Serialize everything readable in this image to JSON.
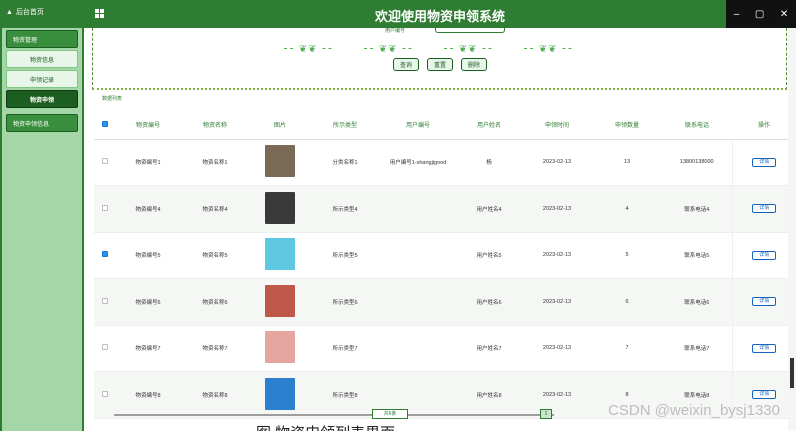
{
  "app": {
    "home_label": "后台首页",
    "title": "欢迎使用物资申领系统",
    "win": {
      "minimize": "–",
      "maximize": "▢",
      "close": "✕"
    }
  },
  "sidebar": {
    "group1": "物资管理",
    "items": [
      "物资信息",
      "申领记录"
    ],
    "active": "物资申领",
    "group2": "物资申领信息"
  },
  "search": {
    "hint": "用户编号",
    "buttons": [
      "查询",
      "重置",
      "删除"
    ]
  },
  "data_label": "数据列表",
  "table": {
    "headers": [
      "物资编号",
      "物资名称",
      "图片",
      "所示类型",
      "用户编号",
      "用户姓名",
      "申领时间",
      "申领数量",
      "联系电话",
      "操作"
    ],
    "rows": [
      {
        "checked": false,
        "code": "物资编号1",
        "name": "物资名称1",
        "img": "#7a6a55",
        "type": "分类名称1",
        "user_id": "用户编号1-shangjigood",
        "user_name": "杨",
        "date": "2023-02-13",
        "qty": "13",
        "phone": "13800138000",
        "op": "详情"
      },
      {
        "checked": false,
        "code": "物资编号4",
        "name": "物资名称4",
        "img": "#3a3a3a",
        "type": "所示类型4",
        "user_id": "",
        "user_name": "用户姓名4",
        "date": "2023-02-13",
        "qty": "4",
        "phone": "联系电话4",
        "op": "详情"
      },
      {
        "checked": true,
        "code": "物资编号5",
        "name": "物资名称5",
        "img": "#5ec8e0",
        "type": "所示类型5",
        "user_id": "",
        "user_name": "用户姓名5",
        "date": "2023-02-13",
        "qty": "5",
        "phone": "联系电话5",
        "op": "详情"
      },
      {
        "checked": false,
        "code": "物资编号6",
        "name": "物资名称6",
        "img": "#c0584a",
        "type": "所示类型6",
        "user_id": "",
        "user_name": "用户姓名6",
        "date": "2023-02-13",
        "qty": "6",
        "phone": "联系电话6",
        "op": "详情"
      },
      {
        "checked": false,
        "code": "物资编号7",
        "name": "物资名称7",
        "img": "#e6a6a0",
        "type": "所示类型7",
        "user_id": "",
        "user_name": "用户姓名7",
        "date": "2023-02-13",
        "qty": "7",
        "phone": "联系电话7",
        "op": "详情"
      },
      {
        "checked": false,
        "code": "物资编号8",
        "name": "物资名称8",
        "img": "#2d7fd0",
        "type": "所示类型8",
        "user_id": "",
        "user_name": "用户姓名8",
        "date": "2023-02-13",
        "qty": "8",
        "phone": "联系电话8",
        "op": "详情"
      }
    ]
  },
  "pager": {
    "label": "共6条",
    "current": "1"
  },
  "watermark": "CSDN @weixin_bysj1330",
  "caption": "图 物资申领列表界面"
}
